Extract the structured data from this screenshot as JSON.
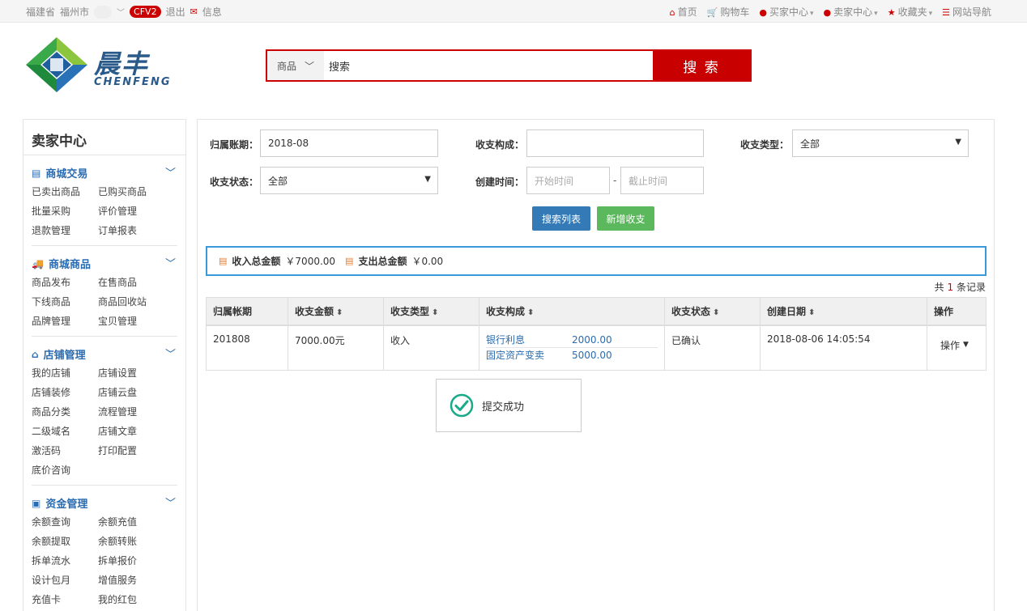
{
  "topbar": {
    "province": "福建省",
    "city": "福州市",
    "badge": "CFV2",
    "logout": "退出",
    "messages": "信息",
    "home": "首页",
    "cart": "购物车",
    "buyer_center": "买家中心",
    "seller_center": "卖家中心",
    "favorites": "收藏夹",
    "site_nav": "网站导航"
  },
  "logo": {
    "cn": "晨丰",
    "en": "CHENFENG"
  },
  "search": {
    "category": "商品",
    "query": "搜索",
    "button": "搜 索"
  },
  "sidebar": {
    "title": "卖家中心",
    "groups": [
      {
        "label": "商城交易",
        "items": [
          "已卖出商品",
          "已购买商品",
          "批量采购",
          "评价管理",
          "退款管理",
          "订单报表"
        ]
      },
      {
        "label": "商城商品",
        "items": [
          "商品发布",
          "在售商品",
          "下线商品",
          "商品回收站",
          "品牌管理",
          "宝贝管理"
        ]
      },
      {
        "label": "店铺管理",
        "items": [
          "我的店铺",
          "店铺设置",
          "店铺装修",
          "店铺云盘",
          "商品分类",
          "流程管理",
          "二级域名",
          "店铺文章",
          "激活码",
          "打印配置",
          "底价咨询"
        ]
      },
      {
        "label": "资金管理",
        "items": [
          "余额查询",
          "余额充值",
          "余额提取",
          "余额转账",
          "拆单流水",
          "拆单报价",
          "设计包月",
          "增值服务",
          "充值卡",
          "我的红包"
        ]
      }
    ]
  },
  "filters": {
    "period_label": "归属账期：",
    "period_value": "2018-08",
    "composition_label": "收支构成：",
    "composition_value": "",
    "type_label": "收支类型：",
    "type_value": "全部",
    "status_label": "收支状态：",
    "status_value": "全部",
    "created_label": "创建时间：",
    "start_placeholder": "开始时间",
    "end_placeholder": "截止时间",
    "dash": "-",
    "search_button": "搜索列表",
    "add_button": "新增收支"
  },
  "summary": {
    "income_label": "收入总金额",
    "income_value": "￥7000.00",
    "expense_label": "支出总金额",
    "expense_value": "￥0.00"
  },
  "count": {
    "prefix": "共",
    "n": "1",
    "suffix": "条记录"
  },
  "table": {
    "headers": [
      "归属帐期",
      "收支金额",
      "收支类型",
      "收支构成",
      "收支状态",
      "创建日期",
      "操作"
    ],
    "row": {
      "period": "201808",
      "amount": "7000.00元",
      "type": "收入",
      "comp": [
        {
          "name": "银行利息",
          "value": "2000.00"
        },
        {
          "name": "固定资产变卖",
          "value": "5000.00"
        }
      ],
      "status": "已确认",
      "created": "2018-08-06 14:05:54",
      "action": "操作"
    }
  },
  "toast": {
    "message": "提交成功"
  },
  "colors": {
    "brand_red": "#c80000",
    "primary_blue": "#337ab7",
    "success_green": "#5cb85c",
    "link_blue": "#2b6cb0"
  }
}
